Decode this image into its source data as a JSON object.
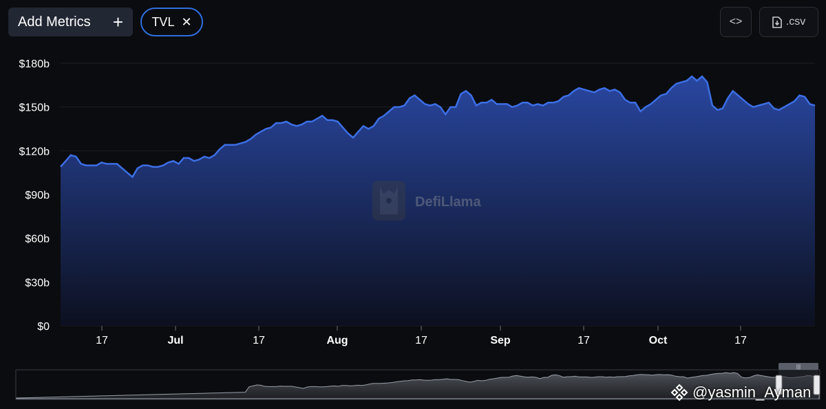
{
  "toolbar": {
    "add_metrics_label": "Add Metrics",
    "add_icon": "+",
    "metric_pill_label": "TVL",
    "remove_icon": "✕",
    "embed_icon": "<>",
    "csv_label": ".csv"
  },
  "watermark": {
    "logo_text": "DefiLlama"
  },
  "credit": {
    "handle": "@yasmin_Ayman"
  },
  "colors": {
    "accent": "#2f6fe0",
    "line": "#3c6fe6",
    "background": "#0b0c0f"
  },
  "chart_data": {
    "type": "area",
    "series": [
      {
        "values": [
          109,
          113,
          117,
          116,
          111,
          110,
          110,
          110,
          112,
          111,
          111,
          111,
          108,
          105,
          102,
          108,
          110,
          110,
          109,
          109,
          110,
          112,
          113,
          111,
          115,
          115,
          113,
          114,
          116,
          115,
          117,
          121,
          124,
          124,
          124,
          125,
          126,
          128,
          131,
          133,
          135,
          136,
          139,
          139,
          140,
          138,
          137,
          138,
          140,
          140,
          142,
          144,
          141,
          141,
          140,
          136,
          132,
          129,
          133,
          137,
          135,
          137,
          142,
          144,
          147,
          150,
          150,
          151,
          156,
          158,
          155,
          152,
          151,
          152,
          150,
          145,
          150,
          150,
          159,
          161,
          158,
          151,
          153,
          153,
          155,
          152,
          152,
          152,
          150,
          151,
          153,
          153,
          151,
          152,
          151,
          153,
          153,
          154,
          157,
          158,
          161,
          163,
          162,
          161,
          160,
          162,
          163,
          161,
          162,
          160,
          155,
          153,
          153,
          147,
          150,
          152,
          155,
          158,
          159,
          163,
          166,
          167,
          168,
          171,
          168,
          171,
          167,
          151,
          148,
          149,
          156,
          161,
          158,
          155,
          152,
          150,
          151,
          152,
          153,
          149,
          148,
          150,
          152,
          154,
          158,
          157,
          152,
          151
        ]
      }
    ],
    "x_ticks": [
      "17",
      "Jul",
      "17",
      "Aug",
      "17",
      "Sep",
      "17",
      "Oct",
      "17"
    ],
    "y_ticks": [
      "$0",
      "$30b",
      "$60b",
      "$90b",
      "$120b",
      "$150b",
      "$180b"
    ],
    "ylim": [
      0,
      180
    ],
    "grid": true
  }
}
